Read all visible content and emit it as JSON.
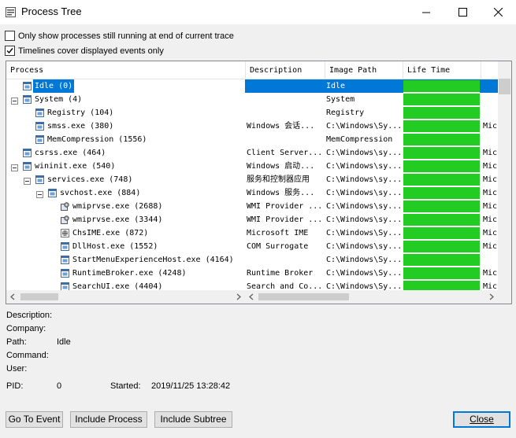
{
  "window": {
    "title": "Process Tree"
  },
  "options": {
    "only_running": {
      "label": "Only show processes still running at end of current trace",
      "checked": false
    },
    "timelines": {
      "label": "Timelines cover displayed events only",
      "checked": true
    }
  },
  "columns": [
    "Process",
    "Description",
    "Image Path",
    "Life Time"
  ],
  "rows": [
    {
      "name": "Idle (0)",
      "description": "",
      "path": "Idle",
      "extra": ""
    },
    {
      "name": "System (4)",
      "description": "",
      "path": "System",
      "extra": ""
    },
    {
      "name": "Registry (104)",
      "description": "",
      "path": "Registry",
      "extra": ""
    },
    {
      "name": "smss.exe (380)",
      "description": "Windows 会话...",
      "path": "C:\\Windows\\Sy...",
      "extra": "Mic"
    },
    {
      "name": "MemCompression (1556)",
      "description": "",
      "path": "MemCompression",
      "extra": ""
    },
    {
      "name": "csrss.exe (464)",
      "description": "Client Server...",
      "path": "C:\\Windows\\sy...",
      "extra": "Mic"
    },
    {
      "name": "wininit.exe (540)",
      "description": "Windows 启动...",
      "path": "C:\\Windows\\sy...",
      "extra": "Mic"
    },
    {
      "name": "services.exe (748)",
      "description": "服务和控制器应用",
      "path": "C:\\Windows\\sy...",
      "extra": "Mic"
    },
    {
      "name": "svchost.exe (884)",
      "description": "Windows 服务...",
      "path": "C:\\Windows\\sy...",
      "extra": "Mic"
    },
    {
      "name": "wmiprvse.exe (2688)",
      "description": "WMI Provider ...",
      "path": "C:\\Windows\\sy...",
      "extra": "Mic"
    },
    {
      "name": "wmiprvse.exe (3344)",
      "description": "WMI Provider ...",
      "path": "C:\\Windows\\sy...",
      "extra": "Mic"
    },
    {
      "name": "ChsIME.exe (872)",
      "description": "Microsoft IME",
      "path": "C:\\Windows\\Sy...",
      "extra": "Mic"
    },
    {
      "name": "DllHost.exe (1552)",
      "description": "COM Surrogate",
      "path": "C:\\Windows\\sy...",
      "extra": "Mic"
    },
    {
      "name": "StartMenuExperienceHost.exe (4164)",
      "description": "",
      "path": "C:\\Windows\\Sy...",
      "extra": ""
    },
    {
      "name": "RuntimeBroker.exe (4248)",
      "description": "Runtime Broker",
      "path": "C:\\Windows\\Sy...",
      "extra": "Mic"
    },
    {
      "name": "SearchUI.exe (4404)",
      "description": "Search and Co...",
      "path": "C:\\Windows\\Sy...",
      "extra": "Mic"
    }
  ],
  "details": {
    "description_label": "Description:",
    "company_label": "Company:",
    "path_label": "Path:",
    "path_value": "Idle",
    "command_label": "Command:",
    "user_label": "User:",
    "pid_label": "PID:",
    "pid_value": "0",
    "started_label": "Started:",
    "started_value": "2019/11/25 13:28:42"
  },
  "buttons": {
    "go_to_event": "Go To Event",
    "include_process": "Include Process",
    "include_subtree": "Include Subtree",
    "close": "Close"
  },
  "colors": {
    "selection": "#0078d7",
    "lifetime": "#22cc22"
  }
}
